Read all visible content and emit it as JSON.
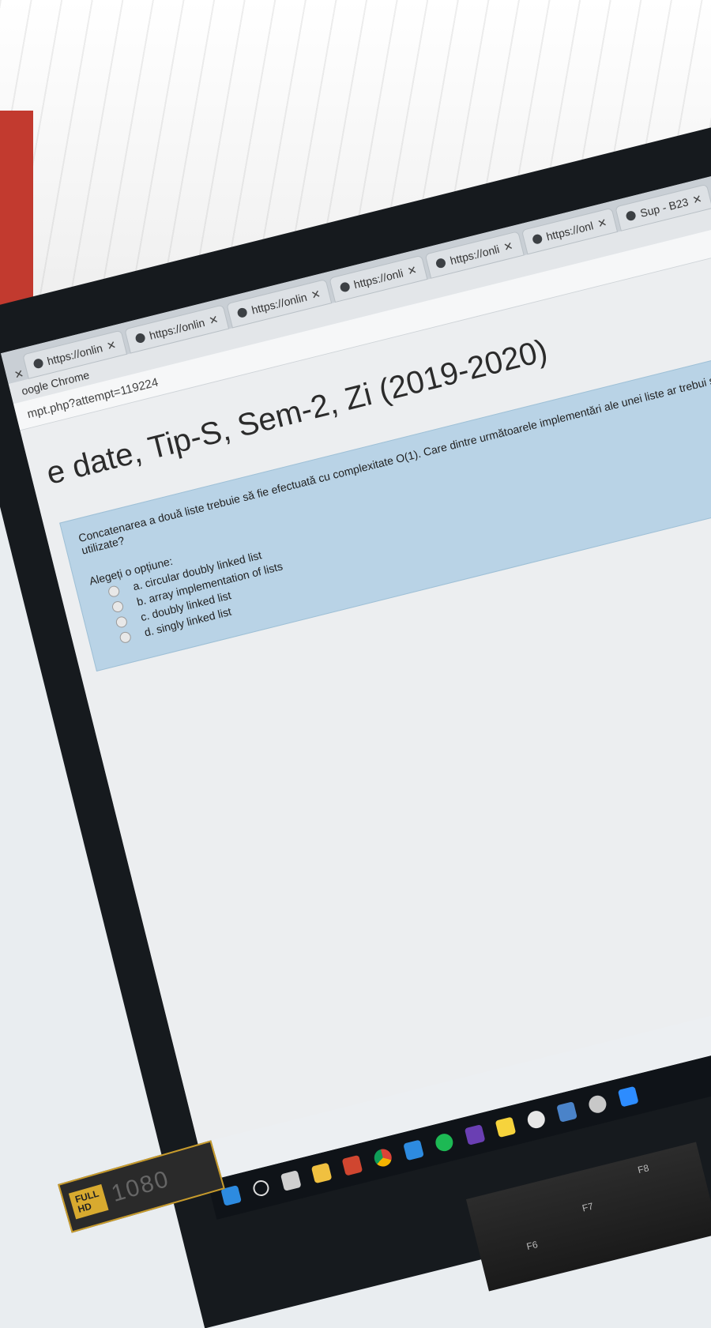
{
  "browser": {
    "tabs": [
      {
        "label": "https://onlin",
        "close": "✕"
      },
      {
        "label": "https://onlin",
        "close": "✕"
      },
      {
        "label": "https://onlin",
        "close": "✕"
      },
      {
        "label": "https://onli",
        "close": "✕"
      },
      {
        "label": "https://onli",
        "close": "✕"
      },
      {
        "label": "https://onl",
        "close": "✕"
      },
      {
        "label": "Sup - B23",
        "close": "✕"
      }
    ],
    "first_tab_close": "✕",
    "window_title": "oogle Chrome",
    "address": "mpt.php?attempt=119224"
  },
  "page": {
    "course_title": "e date, Tip-S, Sem-2, Zi (2019-2020)",
    "question_text": "Concatenarea a două liste trebuie să fie efectuată cu complexitate O(1). Care dintre următoarele implementări ale unei liste ar trebui să fie utilizate?",
    "prompt": "Alegeți o opțiune:",
    "options": [
      {
        "label": "a. circular doubly linked list"
      },
      {
        "label": "b. array implementation of lists"
      },
      {
        "label": "c. doubly linked list"
      },
      {
        "label": "d. singly linked list"
      }
    ]
  },
  "hardware": {
    "badge_full": "FULL",
    "badge_hd": "HD",
    "badge_res": "1080",
    "keys": [
      "F6",
      "F7",
      "F8"
    ]
  },
  "colors": {
    "question_bg": "#b9d3e6",
    "taskbar": "#0f1318",
    "bezel": "#161a1e"
  }
}
